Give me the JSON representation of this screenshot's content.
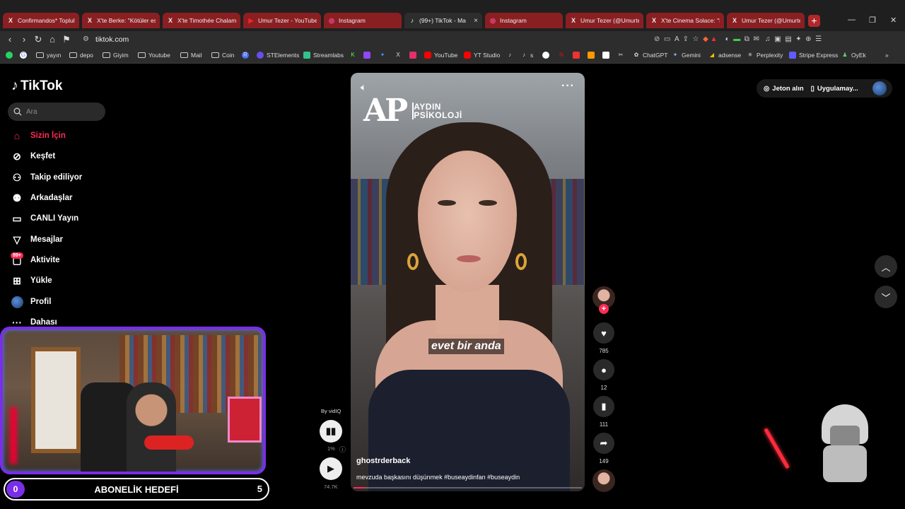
{
  "browser": {
    "tabs": [
      {
        "label": "Confirmandos* Toplulu",
        "icon": "x-logo-icon"
      },
      {
        "label": "X'te Berke: \"Kötüler es",
        "icon": "x-logo-icon"
      },
      {
        "label": "X'te Timothée Chalam",
        "icon": "x-logo-icon"
      },
      {
        "label": "Umur Tezer - YouTube",
        "icon": "youtube-icon"
      },
      {
        "label": "Instagram",
        "icon": "instagram-icon"
      },
      {
        "label": "(99+) TikTok - Ma",
        "icon": "tiktok-icon",
        "active": true
      },
      {
        "label": "Instagram",
        "icon": "instagram-icon"
      },
      {
        "label": "Umur Tezer (@Umurte",
        "icon": "x-logo-icon"
      },
      {
        "label": "X'te Cinema Solace: \"N",
        "icon": "x-logo-icon"
      },
      {
        "label": "Umur Tezer (@Umurte",
        "icon": "x-logo-icon"
      }
    ],
    "url": "tiktok.com",
    "bookmarks": [
      {
        "label": "yayın",
        "type": "folder"
      },
      {
        "label": "depo",
        "type": "folder"
      },
      {
        "label": "Giyim",
        "type": "folder"
      },
      {
        "label": "Youtube",
        "type": "folder"
      },
      {
        "label": "Mail",
        "type": "folder"
      },
      {
        "label": "Coin",
        "type": "folder"
      },
      {
        "label": "STElements",
        "type": "site"
      },
      {
        "label": "Streamlabs",
        "type": "site"
      },
      {
        "label": "YouTube",
        "type": "site"
      },
      {
        "label": "YT Studio",
        "type": "site"
      },
      {
        "label": "s",
        "type": "site"
      },
      {
        "label": "ChatGPT",
        "type": "site"
      },
      {
        "label": "Gemini",
        "type": "site"
      },
      {
        "label": "adsense",
        "type": "site"
      },
      {
        "label": "Perplexity",
        "type": "site"
      },
      {
        "label": "Stripe Express",
        "type": "site"
      },
      {
        "label": "OyEk",
        "type": "site"
      }
    ]
  },
  "tiktok": {
    "brand": "TikTok",
    "search_placeholder": "Ara",
    "nav": [
      {
        "label": "Sizin İçin",
        "icon": "home-icon",
        "active": true
      },
      {
        "label": "Keşfet",
        "icon": "compass-icon"
      },
      {
        "label": "Takip ediliyor",
        "icon": "following-icon"
      },
      {
        "label": "Arkadaşlar",
        "icon": "friends-icon"
      },
      {
        "label": "CANLI Yayın",
        "icon": "live-icon"
      },
      {
        "label": "Mesajlar",
        "icon": "messages-icon"
      },
      {
        "label": "Aktivite",
        "icon": "activity-icon"
      },
      {
        "label": "Yükle",
        "icon": "upload-icon"
      },
      {
        "label": "Profil",
        "icon": "profile-icon"
      },
      {
        "label": "Dahası",
        "icon": "more-icon"
      }
    ],
    "activity_badge": "99+",
    "top_right": {
      "coins": "Jeton alın",
      "app": "Uygulamay..."
    },
    "video": {
      "brand_mark": "AP",
      "brand_line1": "AYDIN",
      "brand_line2": "PSİKOLOJİ",
      "subtitle": "evet bir anda",
      "author": "ghostrderback",
      "caption": "mevzuda başkasını düşünmek #buseaydinfan #buseaydin",
      "progress": 0.05
    },
    "actions": {
      "likes": "785",
      "comments": "12",
      "saves": "111",
      "shares": "149"
    },
    "vidiq": {
      "by": "By vidIQ",
      "percent": "1%",
      "views": "74.7K"
    }
  },
  "stream_overlay": {
    "goal_title": "ABONELİK HEDEFİ",
    "goal_current": "0",
    "goal_target": "5"
  }
}
